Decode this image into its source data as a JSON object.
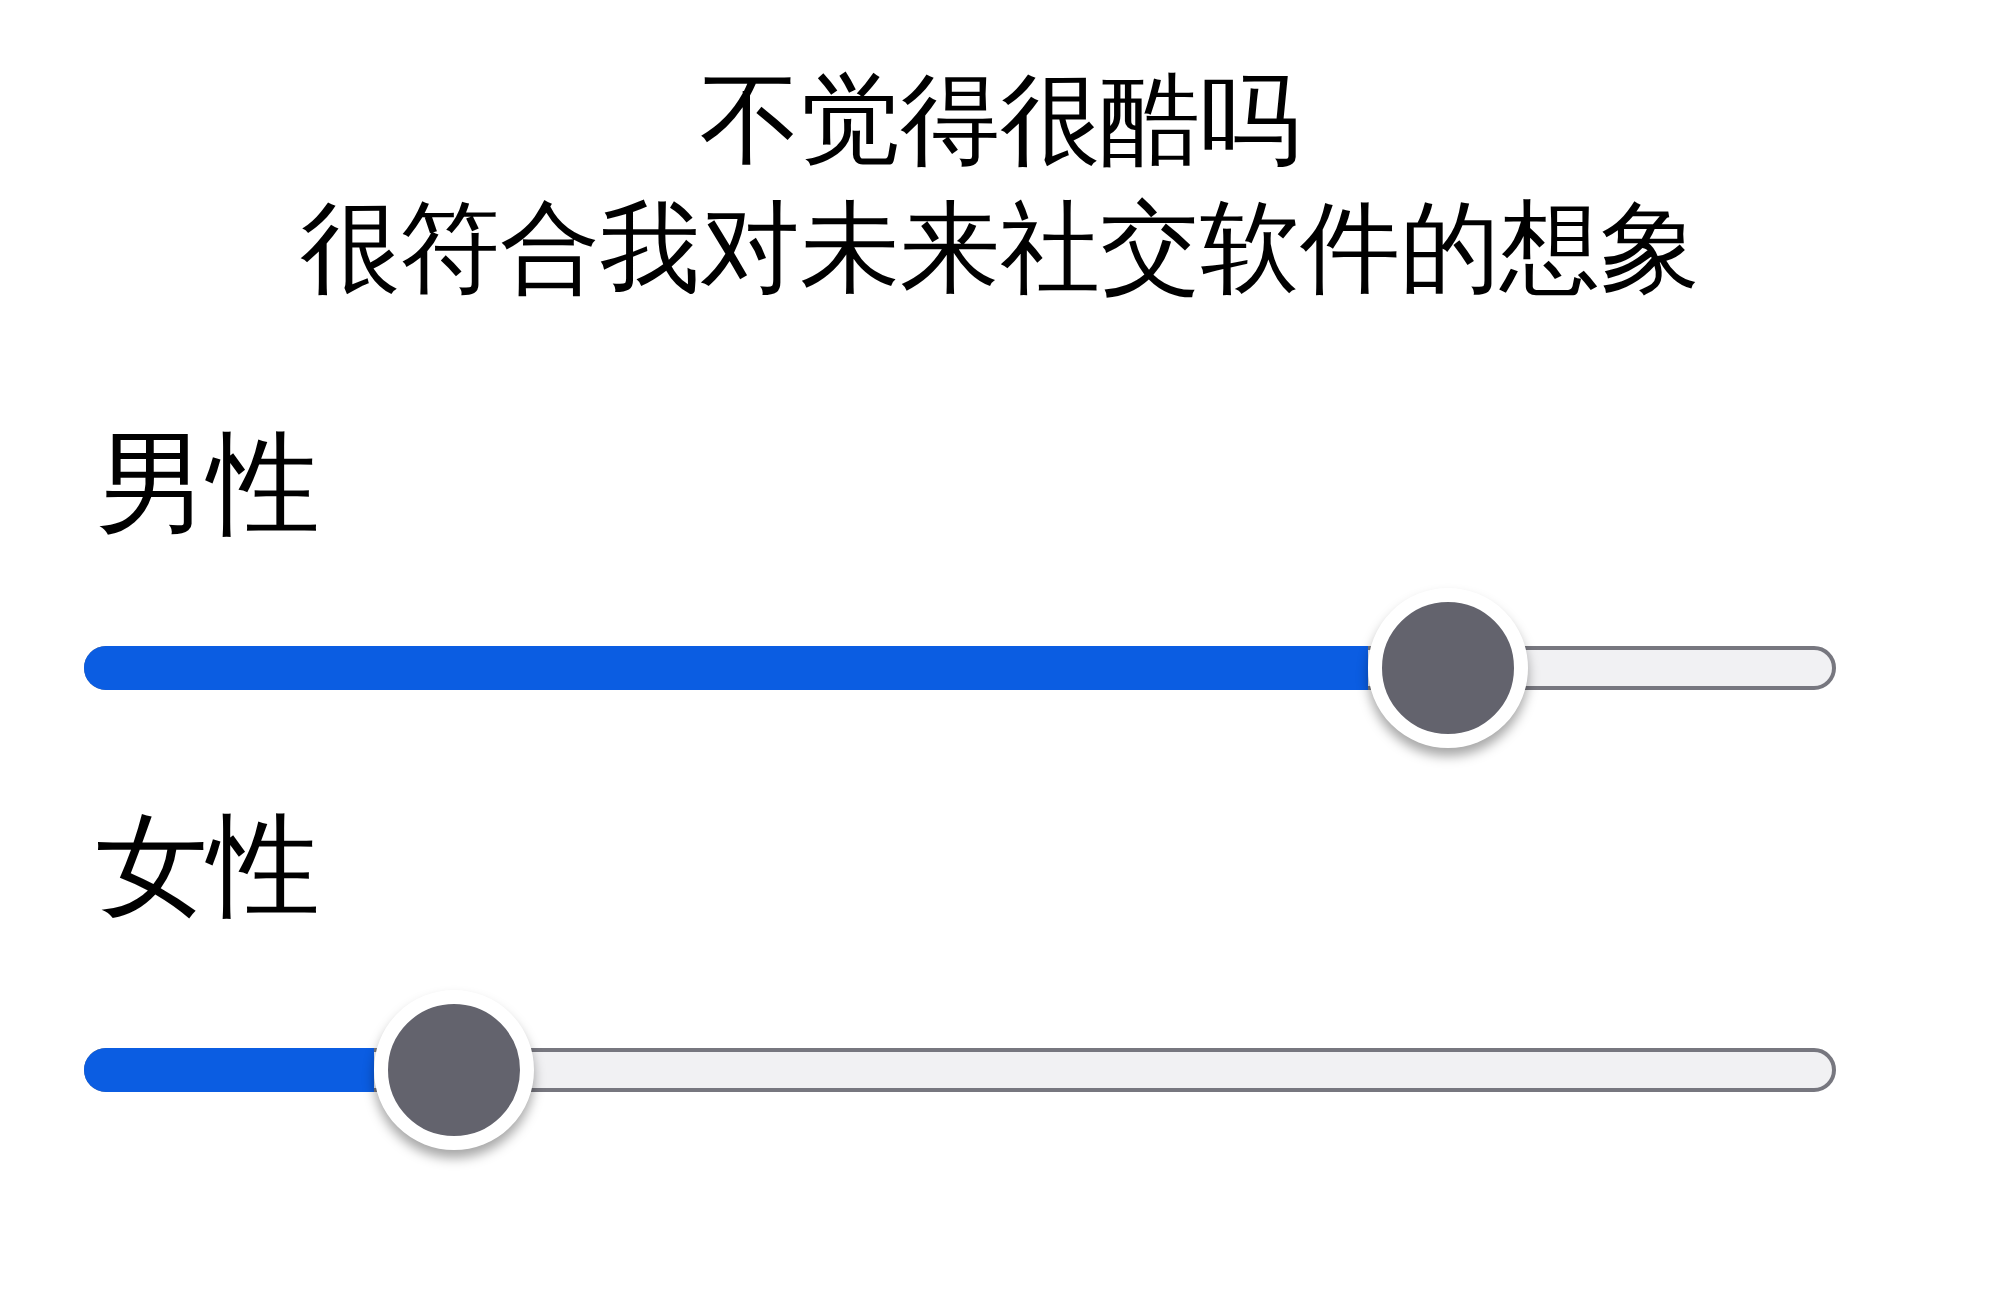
{
  "caption": [
    "不觉得很酷吗",
    "很符合我对未来社交软件的想象"
  ],
  "sliders": [
    {
      "label": "男性",
      "level": 0.78
    },
    {
      "label": "女性",
      "level": 0.21
    }
  ]
}
